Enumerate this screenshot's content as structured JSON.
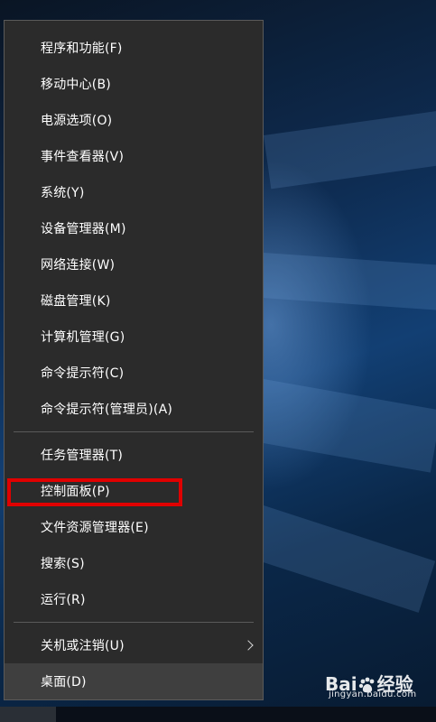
{
  "menu": {
    "group1": [
      {
        "label": "程序和功能(F)"
      },
      {
        "label": "移动中心(B)"
      },
      {
        "label": "电源选项(O)"
      },
      {
        "label": "事件查看器(V)"
      },
      {
        "label": "系统(Y)"
      },
      {
        "label": "设备管理器(M)"
      },
      {
        "label": "网络连接(W)"
      },
      {
        "label": "磁盘管理(K)"
      },
      {
        "label": "计算机管理(G)"
      },
      {
        "label": "命令提示符(C)"
      },
      {
        "label": "命令提示符(管理员)(A)"
      }
    ],
    "group2": [
      {
        "label": "任务管理器(T)"
      },
      {
        "label": "控制面板(P)"
      },
      {
        "label": "文件资源管理器(E)"
      },
      {
        "label": "搜索(S)"
      },
      {
        "label": "运行(R)"
      }
    ],
    "group3": [
      {
        "label": "关机或注销(U)",
        "submenu": true
      },
      {
        "label": "桌面(D)",
        "active": true
      }
    ]
  },
  "annotation": {
    "highlight_color": "#e00000",
    "highlighted_item": "控制面板(P)"
  },
  "watermark": {
    "brand_left": "Bai",
    "brand_right": "经验",
    "url": "jingyan.baidu.com"
  },
  "colors": {
    "menu_bg": "#2b2b2b",
    "menu_text": "#ffffff",
    "divider": "#5a5a5a",
    "active_bg": "#3f3f3f"
  }
}
